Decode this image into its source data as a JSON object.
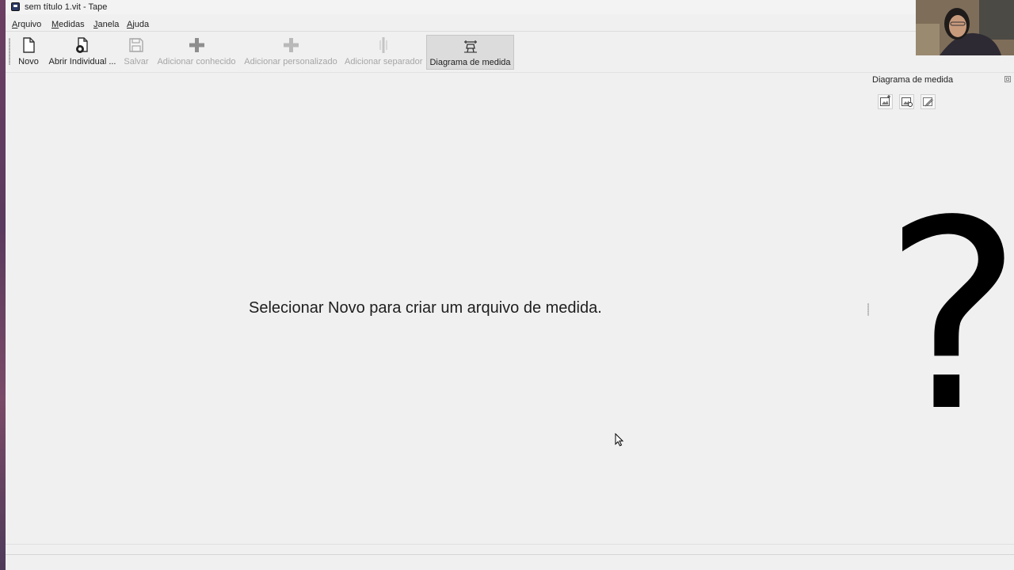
{
  "window": {
    "title": "sem título 1.vit - Tape"
  },
  "menubar": {
    "items": [
      {
        "first": "A",
        "rest": "rquivo"
      },
      {
        "first": "M",
        "rest": "edidas"
      },
      {
        "first": "J",
        "rest": "anela"
      },
      {
        "first": "A",
        "rest": "juda"
      }
    ]
  },
  "toolbar": {
    "buttons": [
      {
        "label": "Novo",
        "icon": "new-file-icon",
        "enabled": true
      },
      {
        "label": "Abrir Individual ...",
        "icon": "open-individual-icon",
        "enabled": true
      },
      {
        "label": "Salvar",
        "icon": "save-icon",
        "enabled": false
      },
      {
        "label": "Adicionar conhecido",
        "icon": "plus-icon",
        "enabled": false
      },
      {
        "label": "Adicionar personalizado",
        "icon": "plus-icon",
        "enabled": false
      },
      {
        "label": "Adicionar separador",
        "icon": "separator-icon",
        "enabled": false
      },
      {
        "label": "Diagrama de medida",
        "icon": "measurement-diagram-icon",
        "enabled": true,
        "active": true
      }
    ]
  },
  "main": {
    "message": "Selecionar Novo para criar um arquivo de medida."
  },
  "dock": {
    "title": "Diagrama de medida",
    "diagram_glyph": "?"
  },
  "colors": {
    "background": "#f0f0f0",
    "active_button": "#dcdcdc",
    "disabled_text": "#a6a6a6"
  }
}
